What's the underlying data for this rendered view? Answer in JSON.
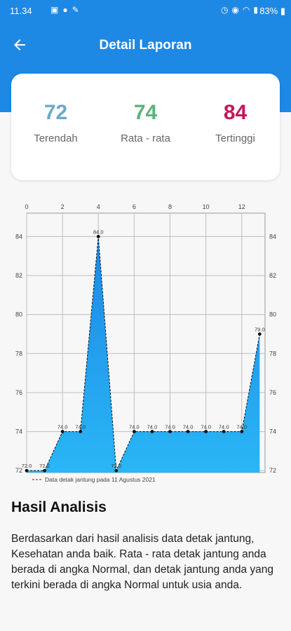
{
  "status_bar": {
    "time": "11.34",
    "battery": "83%",
    "left_icons": [
      "gallery-icon",
      "notification-icon",
      "tools-icon"
    ],
    "right_icons": [
      "alarm-icon",
      "location-icon",
      "wifi-icon",
      "signal-icon",
      "battery-icon"
    ]
  },
  "header": {
    "title": "Detail Laporan",
    "back_icon": "arrow-left-icon",
    "color": "#1e88e5"
  },
  "summary": [
    {
      "value": "72",
      "label": "Terendah",
      "color": "#6fa8c8"
    },
    {
      "value": "74",
      "label": "Rata - rata",
      "color": "#5bb37b"
    },
    {
      "value": "84",
      "label": "Tertinggi",
      "color": "#c2185b"
    }
  ],
  "chart_data": {
    "type": "area",
    "x": [
      0,
      1,
      2,
      3,
      4,
      5,
      6,
      7,
      8,
      9,
      10,
      11,
      12,
      13
    ],
    "x_ticks": [
      "0",
      "2",
      "4",
      "6",
      "8",
      "10",
      "12"
    ],
    "y_ticks": [
      "72",
      "74",
      "76",
      "78",
      "80",
      "82",
      "84"
    ],
    "xlim": [
      0,
      13.3
    ],
    "ylim": [
      71.9,
      85.2
    ],
    "grid": true,
    "legend_position": "bottom-left",
    "series": [
      {
        "name": "Data detak jantung pada 11 Agustus 2021",
        "values": [
          72,
          72,
          74,
          74,
          84,
          72,
          74,
          74,
          74,
          74,
          74,
          74,
          74,
          79
        ],
        "labels": [
          "72.0",
          "72.0",
          "74.0",
          "74.0",
          "84.0",
          "72.0",
          "74.0",
          "74.0",
          "74.0",
          "74.0",
          "74.0",
          "74.0",
          "74.0",
          "79.0"
        ],
        "fill_top": "#1e88e5",
        "fill_bottom": "#29b6f6"
      }
    ]
  },
  "analysis": {
    "title": "Hasil Analisis",
    "body": "Berdasarkan dari hasil analisis data detak jantung, Kesehatan anda baik. Rata - rata detak jantung anda berada di angka Normal, dan detak jantung anda yang terkini berada di angka Normal untuk usia anda."
  }
}
